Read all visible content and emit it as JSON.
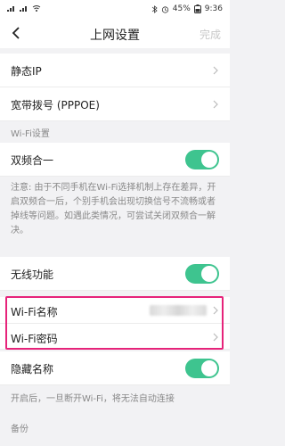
{
  "status_bar": {
    "left_icons": [
      "sim-signal-icon",
      "sim-signal-icon",
      "wifi-icon"
    ],
    "right": {
      "battery": "45%",
      "time": "9:36"
    }
  },
  "nav": {
    "title": "上网设置",
    "done": "完成"
  },
  "rows_top": [
    {
      "label": "静态IP"
    },
    {
      "label": "宽带拨号 (PPPOE)"
    }
  ],
  "wifi_section": {
    "header": "Wi-Fi设置",
    "dual_band": {
      "label": "双频合一",
      "enabled": true
    },
    "note": "注意: 由于不同手机在Wi-Fi选择机制上存在差异，开启双频合一后，个别手机会出现切换信号不流畅或者掉线等问题。如遇此类情况，可尝试关闭双频合一解决。"
  },
  "wireless": {
    "function": {
      "label": "无线功能",
      "enabled": true
    },
    "ssid": {
      "label": "Wi-Fi名称"
    },
    "password": {
      "label": "Wi-Fi密码"
    },
    "hidden": {
      "label": "隐藏名称",
      "enabled": true
    },
    "hidden_note": "开启后，一旦断开Wi-Fi，将无法自动连接"
  },
  "backup_section": {
    "header": "备份"
  },
  "colors": {
    "toggle_on": "#3ec48f",
    "highlight": "#e6237a",
    "done_disabled": "#c8c8c8"
  }
}
